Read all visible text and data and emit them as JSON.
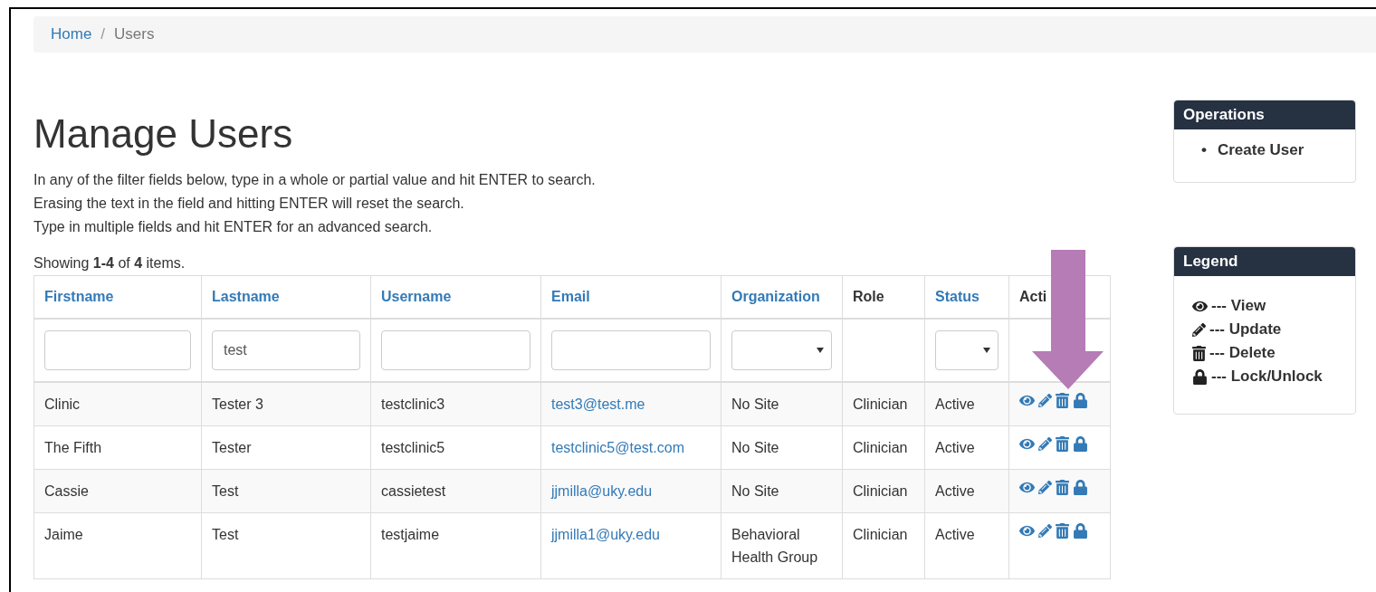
{
  "breadcrumb": [
    {
      "label": "Home",
      "link": true
    },
    {
      "label": "Users",
      "link": false
    }
  ],
  "breadcrumb_separator": "/",
  "title": "Manage Users",
  "instructions": [
    "In any of the filter fields below, type in a whole or partial value and hit ENTER to search.",
    "Erasing the text in the field and hitting ENTER will reset the search.",
    "Type in multiple fields and hit ENTER for an advanced search."
  ],
  "summary": "Showing **1-4** of **4** items.",
  "table": {
    "columns": [
      {
        "label": "Firstname",
        "sortable": true,
        "filter": {
          "kind": "text"
        }
      },
      {
        "label": "Lastname",
        "sortable": true,
        "filter": {
          "kind": "text",
          "value": "test"
        }
      },
      {
        "label": "Username",
        "sortable": true,
        "filter": {
          "kind": "text"
        }
      },
      {
        "label": "Email",
        "sortable": true,
        "filter": {
          "kind": "text"
        }
      },
      {
        "label": "Organization",
        "sortable": true,
        "filter": {
          "kind": "select"
        }
      },
      {
        "label": "Role",
        "sortable": false,
        "filter": {
          "kind": "none"
        }
      },
      {
        "label": "Status",
        "sortable": true,
        "filter": {
          "kind": "select"
        }
      },
      {
        "label": "Acti",
        "sortable": false,
        "filter": {
          "kind": "none"
        }
      }
    ],
    "rows": [
      {
        "firstname": "Clinic",
        "lastname": "Tester 3",
        "username": "testclinic3",
        "email": "test3@test.me",
        "organization": "No Site",
        "role": "Clinician",
        "status": "Active"
      },
      {
        "firstname": "The Fifth",
        "lastname": "Tester",
        "username": "testclinic5",
        "email": "testclinic5@test.com",
        "organization": "No Site",
        "role": "Clinician",
        "status": "Active"
      },
      {
        "firstname": "Cassie",
        "lastname": "Test",
        "username": "cassietest",
        "email": "jjmilla@uky.edu",
        "organization": "No Site",
        "role": "Clinician",
        "status": "Active"
      },
      {
        "firstname": "Jaime",
        "lastname": "Test",
        "username": "testjaime",
        "email": "jjmilla1@uky.edu",
        "organization": "Behavioral Health Group",
        "role": "Clinician",
        "status": "Active"
      }
    ]
  },
  "operations": {
    "title": "Operations",
    "bullet": "•",
    "items": [
      "Create User"
    ]
  },
  "legend": {
    "title": "Legend",
    "items": [
      {
        "kind": "view",
        "label": "--- View"
      },
      {
        "kind": "update",
        "label": "--- Update"
      },
      {
        "kind": "delete",
        "label": "--- Delete"
      },
      {
        "kind": "lock",
        "label": "--- Lock/Unlock"
      }
    ]
  }
}
